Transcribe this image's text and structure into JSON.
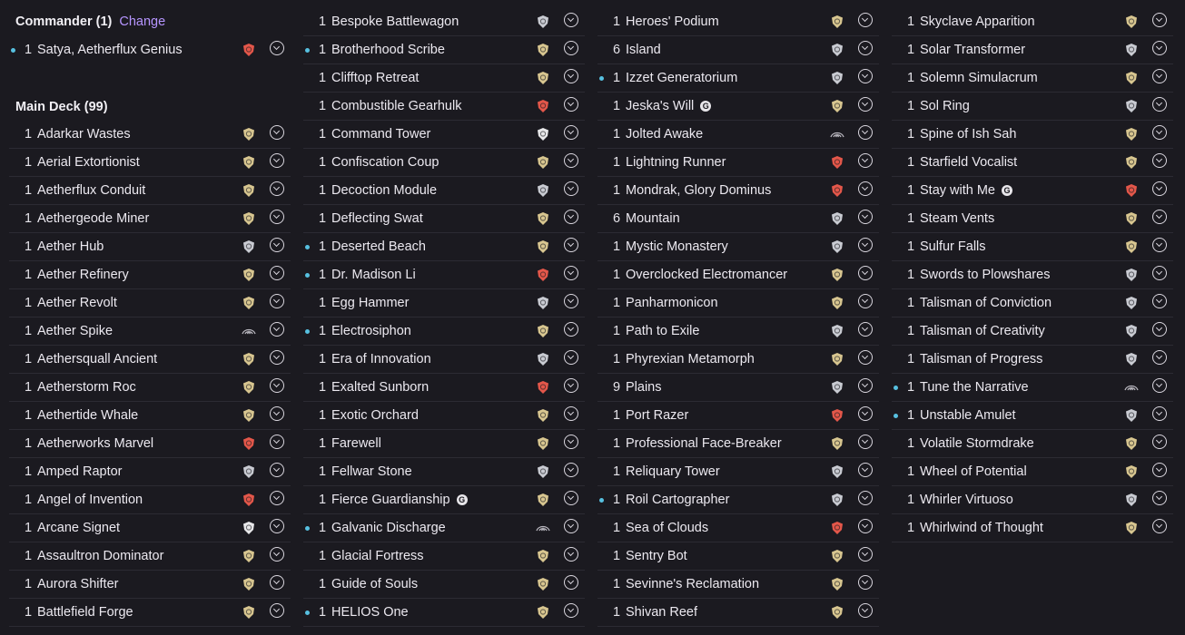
{
  "commander_section": {
    "title": "Commander (1)",
    "change_label": "Change",
    "cards": [
      {
        "qty": "1",
        "name": "Satya, Aetherflux Genius",
        "new": true,
        "icon": "red-set-icon",
        "color": "#e4574a"
      }
    ]
  },
  "main_section": {
    "title": "Main Deck (99)"
  },
  "columns": [
    [
      {
        "qty": "1",
        "name": "Adarkar Wastes",
        "icon": "gold-set-icon",
        "color": "#d8c690"
      },
      {
        "qty": "1",
        "name": "Aerial Extortionist",
        "icon": "gold-set-icon",
        "color": "#d8c690"
      },
      {
        "qty": "1",
        "name": "Aetherflux Conduit",
        "icon": "gold-set-icon",
        "color": "#d8c690"
      },
      {
        "qty": "1",
        "name": "Aethergeode Miner",
        "icon": "gold-set-icon",
        "color": "#d8c690"
      },
      {
        "qty": "1",
        "name": "Aether Hub",
        "icon": "silver-set-icon",
        "color": "#c9cbd2"
      },
      {
        "qty": "1",
        "name": "Aether Refinery",
        "icon": "gold-set-icon",
        "color": "#d8c690"
      },
      {
        "qty": "1",
        "name": "Aether Revolt",
        "icon": "gold-set-icon",
        "color": "#d8c690"
      },
      {
        "qty": "1",
        "name": "Aether Spike",
        "icon": "outline-set-icon",
        "color": "#b9b7bf"
      },
      {
        "qty": "1",
        "name": "Aethersquall Ancient",
        "icon": "gold-set-icon",
        "color": "#d8c690"
      },
      {
        "qty": "1",
        "name": "Aetherstorm Roc",
        "icon": "gold-set-icon",
        "color": "#d8c690"
      },
      {
        "qty": "1",
        "name": "Aethertide Whale",
        "icon": "gold-set-icon",
        "color": "#d8c690"
      },
      {
        "qty": "1",
        "name": "Aetherworks Marvel",
        "icon": "red-set-icon",
        "color": "#e4574a"
      },
      {
        "qty": "1",
        "name": "Amped Raptor",
        "icon": "silver-set-icon",
        "color": "#c9cbd2"
      },
      {
        "qty": "1",
        "name": "Angel of Invention",
        "icon": "red-set-icon",
        "color": "#e4574a"
      },
      {
        "qty": "1",
        "name": "Arcane Signet",
        "icon": "white-set-icon",
        "color": "#e8e8ea"
      },
      {
        "qty": "1",
        "name": "Assaultron Dominator",
        "icon": "gold-set-icon",
        "color": "#d8c690"
      },
      {
        "qty": "1",
        "name": "Aurora Shifter",
        "icon": "gold-set-icon",
        "color": "#d8c690"
      },
      {
        "qty": "1",
        "name": "Battlefield Forge",
        "icon": "gold-set-icon",
        "color": "#d8c690"
      }
    ],
    [
      {
        "qty": "1",
        "name": "Bespoke Battlewagon",
        "icon": "silver-set-icon",
        "color": "#c9cbd2"
      },
      {
        "qty": "1",
        "name": "Brotherhood Scribe",
        "new": true,
        "icon": "gold-set-icon",
        "color": "#d8c690"
      },
      {
        "qty": "1",
        "name": "Clifftop Retreat",
        "icon": "gold-set-icon",
        "color": "#d8c690"
      },
      {
        "qty": "1",
        "name": "Combustible Gearhulk",
        "icon": "red-set-icon",
        "color": "#e4574a"
      },
      {
        "qty": "1",
        "name": "Command Tower",
        "icon": "white-set-icon",
        "color": "#e8e8ea"
      },
      {
        "qty": "1",
        "name": "Confiscation Coup",
        "icon": "gold-set-icon",
        "color": "#d8c690"
      },
      {
        "qty": "1",
        "name": "Decoction Module",
        "icon": "silver-set-icon",
        "color": "#c9cbd2"
      },
      {
        "qty": "1",
        "name": "Deflecting Swat",
        "icon": "gold-set-icon",
        "color": "#d8c690"
      },
      {
        "qty": "1",
        "name": "Deserted Beach",
        "new": true,
        "icon": "gold-set-icon",
        "color": "#d8c690"
      },
      {
        "qty": "1",
        "name": "Dr. Madison Li",
        "new": true,
        "icon": "red-set-icon",
        "color": "#e4574a"
      },
      {
        "qty": "1",
        "name": "Egg Hammer",
        "icon": "silver-set-icon",
        "color": "#c9cbd2"
      },
      {
        "qty": "1",
        "name": "Electrosiphon",
        "new": true,
        "icon": "gold-set-icon",
        "color": "#d8c690"
      },
      {
        "qty": "1",
        "name": "Era of Innovation",
        "icon": "silver-set-icon",
        "color": "#c9cbd2"
      },
      {
        "qty": "1",
        "name": "Exalted Sunborn",
        "icon": "red-set-icon",
        "color": "#e4574a"
      },
      {
        "qty": "1",
        "name": "Exotic Orchard",
        "icon": "gold-set-icon",
        "color": "#d8c690"
      },
      {
        "qty": "1",
        "name": "Farewell",
        "icon": "gold-set-icon",
        "color": "#d8c690"
      },
      {
        "qty": "1",
        "name": "Fellwar Stone",
        "icon": "silver-set-icon",
        "color": "#c9cbd2"
      },
      {
        "qty": "1",
        "name": "Fierce Guardianship",
        "gc": true,
        "icon": "gold-set-icon",
        "color": "#d8c690"
      },
      {
        "qty": "1",
        "name": "Galvanic Discharge",
        "new": true,
        "icon": "outline-set-icon",
        "color": "#b9b7bf"
      },
      {
        "qty": "1",
        "name": "Glacial Fortress",
        "icon": "gold-set-icon",
        "color": "#d8c690"
      },
      {
        "qty": "1",
        "name": "Guide of Souls",
        "icon": "gold-set-icon",
        "color": "#d8c690"
      },
      {
        "qty": "1",
        "name": "HELIOS One",
        "new": true,
        "icon": "gold-set-icon",
        "color": "#d8c690"
      }
    ],
    [
      {
        "qty": "1",
        "name": "Heroes' Podium",
        "icon": "gold-set-icon",
        "color": "#d8c690"
      },
      {
        "qty": "6",
        "name": "Island",
        "icon": "silver-set-icon",
        "color": "#c9cbd2"
      },
      {
        "qty": "1",
        "name": "Izzet Generatorium",
        "new": true,
        "icon": "silver-set-icon",
        "color": "#c9cbd2"
      },
      {
        "qty": "1",
        "name": "Jeska's Will",
        "gc": true,
        "icon": "gold-set-icon",
        "color": "#d8c690"
      },
      {
        "qty": "1",
        "name": "Jolted Awake",
        "icon": "outline-set-icon",
        "color": "#b9b7bf"
      },
      {
        "qty": "1",
        "name": "Lightning Runner",
        "icon": "red-set-icon",
        "color": "#e4574a"
      },
      {
        "qty": "1",
        "name": "Mondrak, Glory Dominus",
        "icon": "red-set-icon",
        "color": "#e4574a"
      },
      {
        "qty": "6",
        "name": "Mountain",
        "icon": "silver-set-icon",
        "color": "#c9cbd2"
      },
      {
        "qty": "1",
        "name": "Mystic Monastery",
        "icon": "silver-set-icon",
        "color": "#c9cbd2"
      },
      {
        "qty": "1",
        "name": "Overclocked Electromancer",
        "icon": "gold-set-icon",
        "color": "#d8c690"
      },
      {
        "qty": "1",
        "name": "Panharmonicon",
        "icon": "gold-set-icon",
        "color": "#d8c690"
      },
      {
        "qty": "1",
        "name": "Path to Exile",
        "icon": "silver-set-icon",
        "color": "#c9cbd2"
      },
      {
        "qty": "1",
        "name": "Phyrexian Metamorph",
        "icon": "gold-set-icon",
        "color": "#d8c690"
      },
      {
        "qty": "9",
        "name": "Plains",
        "icon": "silver-set-icon",
        "color": "#c9cbd2"
      },
      {
        "qty": "1",
        "name": "Port Razer",
        "icon": "red-set-icon",
        "color": "#e4574a"
      },
      {
        "qty": "1",
        "name": "Professional Face-Breaker",
        "icon": "gold-set-icon",
        "color": "#d8c690"
      },
      {
        "qty": "1",
        "name": "Reliquary Tower",
        "icon": "silver-set-icon",
        "color": "#c9cbd2"
      },
      {
        "qty": "1",
        "name": "Roil Cartographer",
        "new": true,
        "icon": "silver-set-icon",
        "color": "#c9cbd2"
      },
      {
        "qty": "1",
        "name": "Sea of Clouds",
        "icon": "red-set-icon",
        "color": "#e4574a"
      },
      {
        "qty": "1",
        "name": "Sentry Bot",
        "icon": "gold-set-icon",
        "color": "#d8c690"
      },
      {
        "qty": "1",
        "name": "Sevinne's Reclamation",
        "icon": "gold-set-icon",
        "color": "#d8c690"
      },
      {
        "qty": "1",
        "name": "Shivan Reef",
        "icon": "gold-set-icon",
        "color": "#d8c690"
      }
    ],
    [
      {
        "qty": "1",
        "name": "Skyclave Apparition",
        "icon": "gold-set-icon",
        "color": "#d8c690"
      },
      {
        "qty": "1",
        "name": "Solar Transformer",
        "icon": "silver-set-icon",
        "color": "#c9cbd2"
      },
      {
        "qty": "1",
        "name": "Solemn Simulacrum",
        "icon": "gold-set-icon",
        "color": "#d8c690"
      },
      {
        "qty": "1",
        "name": "Sol Ring",
        "icon": "silver-set-icon",
        "color": "#c9cbd2"
      },
      {
        "qty": "1",
        "name": "Spine of Ish Sah",
        "icon": "gold-set-icon",
        "color": "#d8c690"
      },
      {
        "qty": "1",
        "name": "Starfield Vocalist",
        "icon": "gold-set-icon",
        "color": "#d8c690"
      },
      {
        "qty": "1",
        "name": "Stay with Me",
        "gc": true,
        "icon": "red-set-icon",
        "color": "#e4574a"
      },
      {
        "qty": "1",
        "name": "Steam Vents",
        "icon": "gold-set-icon",
        "color": "#d8c690"
      },
      {
        "qty": "1",
        "name": "Sulfur Falls",
        "icon": "gold-set-icon",
        "color": "#d8c690"
      },
      {
        "qty": "1",
        "name": "Swords to Plowshares",
        "icon": "silver-set-icon",
        "color": "#c9cbd2"
      },
      {
        "qty": "1",
        "name": "Talisman of Conviction",
        "icon": "silver-set-icon",
        "color": "#c9cbd2"
      },
      {
        "qty": "1",
        "name": "Talisman of Creativity",
        "icon": "silver-set-icon",
        "color": "#c9cbd2"
      },
      {
        "qty": "1",
        "name": "Talisman of Progress",
        "icon": "silver-set-icon",
        "color": "#c9cbd2"
      },
      {
        "qty": "1",
        "name": "Tune the Narrative",
        "new": true,
        "icon": "outline-set-icon",
        "color": "#b9b7bf"
      },
      {
        "qty": "1",
        "name": "Unstable Amulet",
        "new": true,
        "icon": "silver-set-icon",
        "color": "#c9cbd2"
      },
      {
        "qty": "1",
        "name": "Volatile Stormdrake",
        "icon": "gold-set-icon",
        "color": "#d8c690"
      },
      {
        "qty": "1",
        "name": "Wheel of Potential",
        "icon": "gold-set-icon",
        "color": "#d8c690"
      },
      {
        "qty": "1",
        "name": "Whirler Virtuoso",
        "icon": "silver-set-icon",
        "color": "#c9cbd2"
      },
      {
        "qty": "1",
        "name": "Whirlwind of Thought",
        "icon": "gold-set-icon",
        "color": "#d8c690"
      }
    ]
  ],
  "game_changer_glyph": "G",
  "new_indicator_color": "#57c0e0",
  "accent_color": "#b695ff"
}
